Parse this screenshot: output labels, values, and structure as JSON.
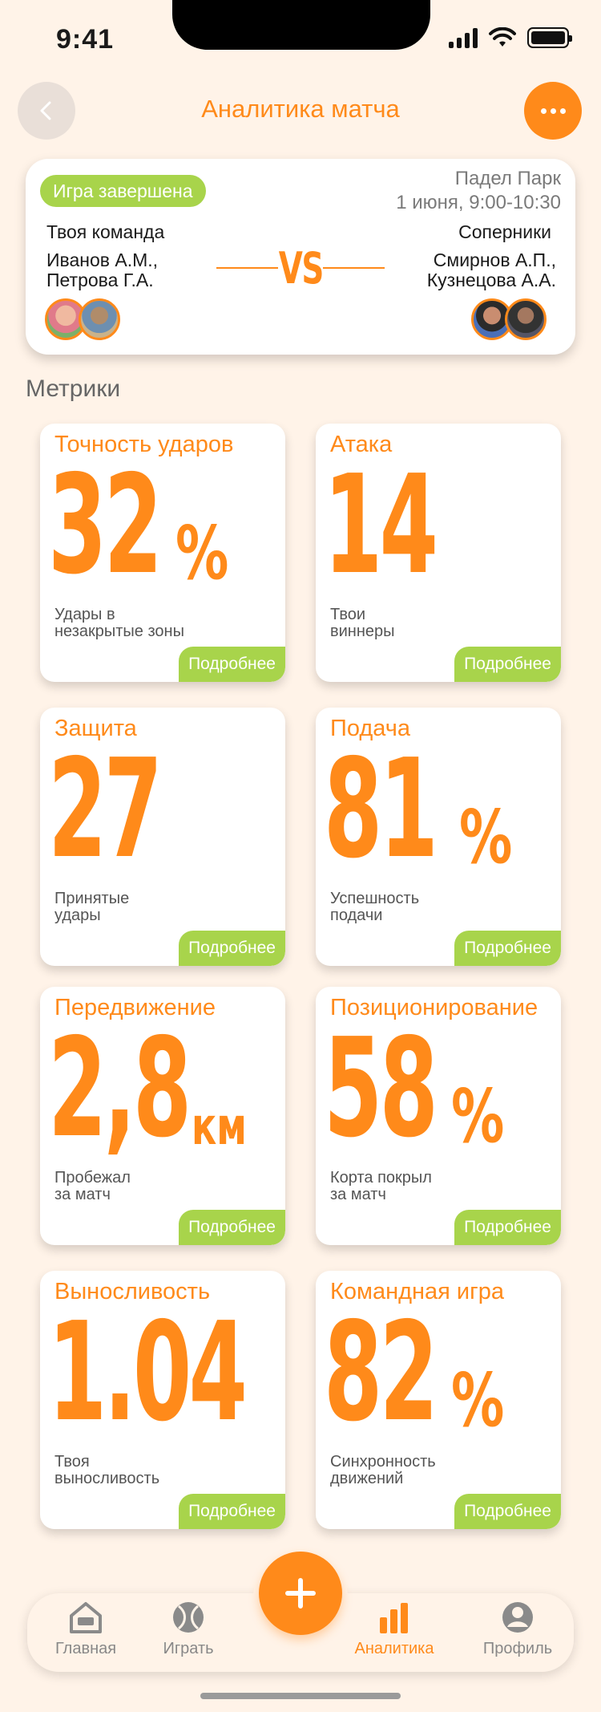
{
  "status_bar": {
    "time": "9:41"
  },
  "header": {
    "title": "Аналитика матча",
    "back_icon": "chevron-left-icon",
    "more_icon": "more-icon"
  },
  "match": {
    "status": "Игра завершена",
    "venue": "Падел Парк",
    "datetime": "1 июня, 9:00-10:30",
    "home_label": "Твоя команда",
    "home_player1": "Иванов А.М.,",
    "home_player2": "Петрова Г.А.",
    "vs": "VS",
    "away_label": "Соперники",
    "away_player1": "Смирнов А.П.,",
    "away_player2": "Кузнецова А.А."
  },
  "metrics_title": "Метрики",
  "more_label": "Подробнее",
  "metrics": [
    {
      "title": "Точность ударов",
      "value": "32",
      "unit": "%",
      "desc": "Удары в\nнезакрытые зоны"
    },
    {
      "title": "Атака",
      "value": "14",
      "unit": "",
      "desc": "Твои\nвиннеры"
    },
    {
      "title": "Защита",
      "value": "27",
      "unit": "",
      "desc": "Принятые\nудары"
    },
    {
      "title": "Подача",
      "value": "81",
      "unit": "%",
      "desc": "Успешность\nподачи"
    },
    {
      "title": "Передвижение",
      "value": "2,8",
      "unit": "км",
      "desc": "Пробежал\nза матч"
    },
    {
      "title": "Позиционирование",
      "value": "58",
      "unit": "%",
      "desc": "Корта покрыл\nза матч"
    },
    {
      "title": "Выносливость",
      "value": "1.04",
      "unit": "",
      "desc": "Твоя\nвыносливость"
    },
    {
      "title": "Командная игра",
      "value": "82",
      "unit": "%",
      "desc": "Синхронность\nдвижений"
    }
  ],
  "tabs": [
    {
      "label": "Главная",
      "icon": "home-icon"
    },
    {
      "label": "Играть",
      "icon": "ball-icon"
    },
    {
      "label": "Аналитика",
      "icon": "bar-chart-icon",
      "active": true
    },
    {
      "label": "Профиль",
      "icon": "profile-icon"
    }
  ],
  "fab_icon": "plus-icon",
  "colors": {
    "accent": "#ff8a1a",
    "green": "#a8d44b",
    "background": "#fff3e8"
  }
}
